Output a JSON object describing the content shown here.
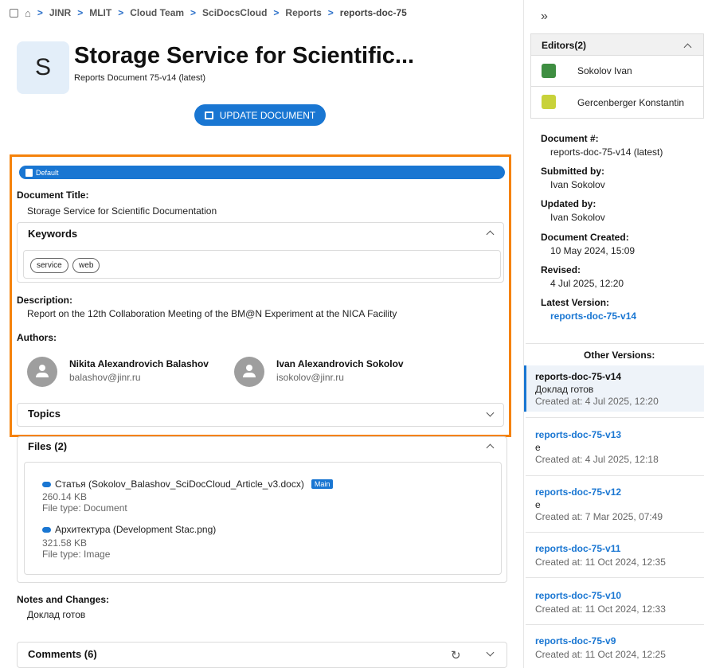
{
  "breadcrumb": [
    "JINR",
    "MLIT",
    "Cloud Team",
    "SciDocsCloud",
    "Reports",
    "reports-doc-75"
  ],
  "header": {
    "avatar_letter": "S",
    "title": "Storage Service for Scientific...",
    "subtitle": "Reports Document 75-v14 (latest)",
    "update_button": "UPDATE DOCUMENT"
  },
  "form": {
    "section_tag": "Default",
    "document_title_label": "Document Title:",
    "document_title": "Storage Service for Scientific Documentation",
    "keywords_label": "Keywords",
    "keywords": [
      "service",
      "web"
    ],
    "description_label": "Description:",
    "description": "Report on the 12th Collaboration Meeting of the BM@N Experiment at the NICA Facility",
    "authors_label": "Authors:",
    "authors": [
      {
        "name": "Nikita Alexandrovich Balashov",
        "email": "balashov@jinr.ru"
      },
      {
        "name": "Ivan Alexandrovich Sokolov",
        "email": "isokolov@jinr.ru"
      }
    ],
    "topics_label": "Topics"
  },
  "files": {
    "title": "Files (2)",
    "items": [
      {
        "name": "Статья (Sokolov_Balashov_SciDocCloud_Article_v3.docx)",
        "badge": "Main",
        "size": "260.14 KB",
        "type": "File type: Document"
      },
      {
        "name": "Архитектура (Development Stac.png)",
        "size": "321.58 KB",
        "type": "File type: Image"
      }
    ]
  },
  "notes": {
    "label": "Notes and Changes:",
    "value": "Доклад готов"
  },
  "comments": {
    "title": "Comments (6)"
  },
  "sidebar": {
    "collapse_glyph": "»",
    "editors_title": "Editors(2)",
    "editors": [
      "Sokolov Ivan",
      "Gercenberger Konstantin"
    ],
    "meta": {
      "doc_num_label": "Document #:",
      "doc_num": "reports-doc-75-v14 (latest)",
      "submitted_label": "Submitted by:",
      "submitted": "Ivan Sokolov",
      "updated_label": "Updated by:",
      "updated": "Ivan Sokolov",
      "created_label": "Document Created:",
      "created": "10 May 2024, 15:09",
      "revised_label": "Revised:",
      "revised": "4 Jul 2025, 12:20",
      "latest_label": "Latest Version:",
      "latest": "reports-doc-75-v14"
    },
    "other_versions_title": "Other Versions:",
    "versions": [
      {
        "name": "reports-doc-75-v14",
        "note": "Доклад готов",
        "date": "Created at: 4 Jul 2025, 12:20"
      },
      {
        "name": "reports-doc-75-v13",
        "note": "e",
        "date": "Created at: 4 Jul 2025, 12:18"
      },
      {
        "name": "reports-doc-75-v12",
        "note": "e",
        "date": "Created at: 7 Mar 2025, 07:49"
      },
      {
        "name": "reports-doc-75-v11",
        "date": "Created at: 11 Oct 2024, 12:35"
      },
      {
        "name": "reports-doc-75-v10",
        "date": "Created at: 11 Oct 2024, 12:33"
      },
      {
        "name": "reports-doc-75-v9",
        "date": "Created at: 11 Oct 2024, 12:25"
      }
    ]
  },
  "colors": {
    "accent": "#1976d2",
    "highlight": "#f5820b"
  }
}
